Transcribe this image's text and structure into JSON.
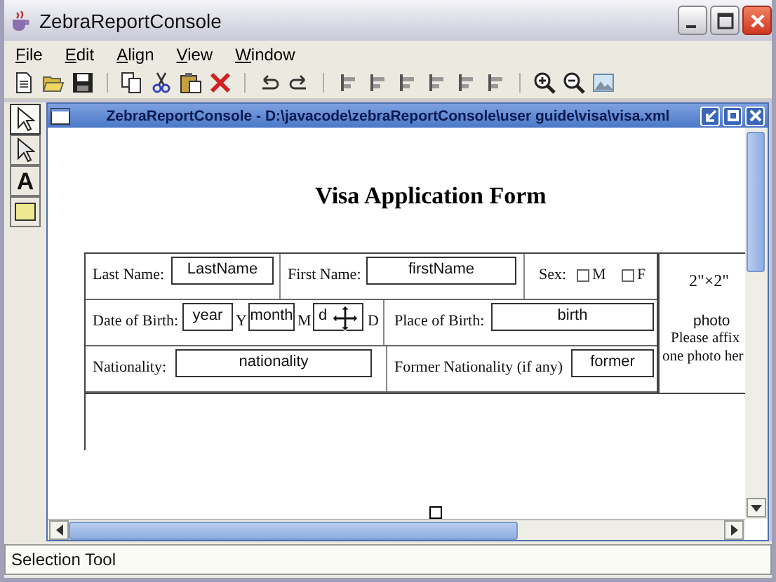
{
  "window": {
    "title": "ZebraReportConsole"
  },
  "menu": [
    {
      "label": "File"
    },
    {
      "label": "Edit"
    },
    {
      "label": "Align"
    },
    {
      "label": "View"
    },
    {
      "label": "Window"
    }
  ],
  "tools": [
    {
      "kind": "arrow",
      "selected": true
    },
    {
      "kind": "arrow",
      "selected": false
    },
    {
      "kind": "text",
      "label": "A",
      "selected": false
    },
    {
      "kind": "box",
      "selected": false
    }
  ],
  "document": {
    "title": "ZebraReportConsole - D:\\javacode\\zebraReportConsole\\user guide\\visa\\visa.xml",
    "form_title": "Visa Application Form",
    "form_lines": [
      [
        {
          "kind": "label",
          "text": "Last Name:"
        },
        {
          "kind": "field",
          "text": "LastName"
        },
        {
          "kind": "divider"
        },
        {
          "kind": "label",
          "text": "First Name:"
        },
        {
          "kind": "field",
          "text": "firstName"
        },
        {
          "kind": "divider"
        },
        {
          "kind": "label",
          "text": "Sex:"
        },
        {
          "kind": "check",
          "text": "M",
          "checked": false
        },
        {
          "kind": "check",
          "text": "F",
          "checked": false
        }
      ],
      [
        {
          "kind": "label",
          "text": "Date of Birth:"
        },
        {
          "kind": "field",
          "text": "year"
        },
        {
          "kind": "label",
          "text": "Y"
        },
        {
          "kind": "field",
          "text": "month"
        },
        {
          "kind": "label",
          "text": "M"
        },
        {
          "kind": "field",
          "text": "d",
          "selected": true
        },
        {
          "kind": "label",
          "text": "D"
        },
        {
          "kind": "divider"
        },
        {
          "kind": "label",
          "text": "Place of Birth:"
        },
        {
          "kind": "field",
          "text": "birth"
        }
      ],
      [
        {
          "kind": "label",
          "text": "Nationality:"
        },
        {
          "kind": "field",
          "text": "nationality"
        },
        {
          "kind": "divider"
        },
        {
          "kind": "label",
          "text": "Former Nationality (if any)"
        },
        {
          "kind": "field",
          "text": "former"
        }
      ]
    ],
    "photo": {
      "size": "2\"×2\"",
      "lines": [
        "photo",
        "Please affix",
        "one photo her"
      ]
    }
  },
  "status_bar": "Selection Tool"
}
